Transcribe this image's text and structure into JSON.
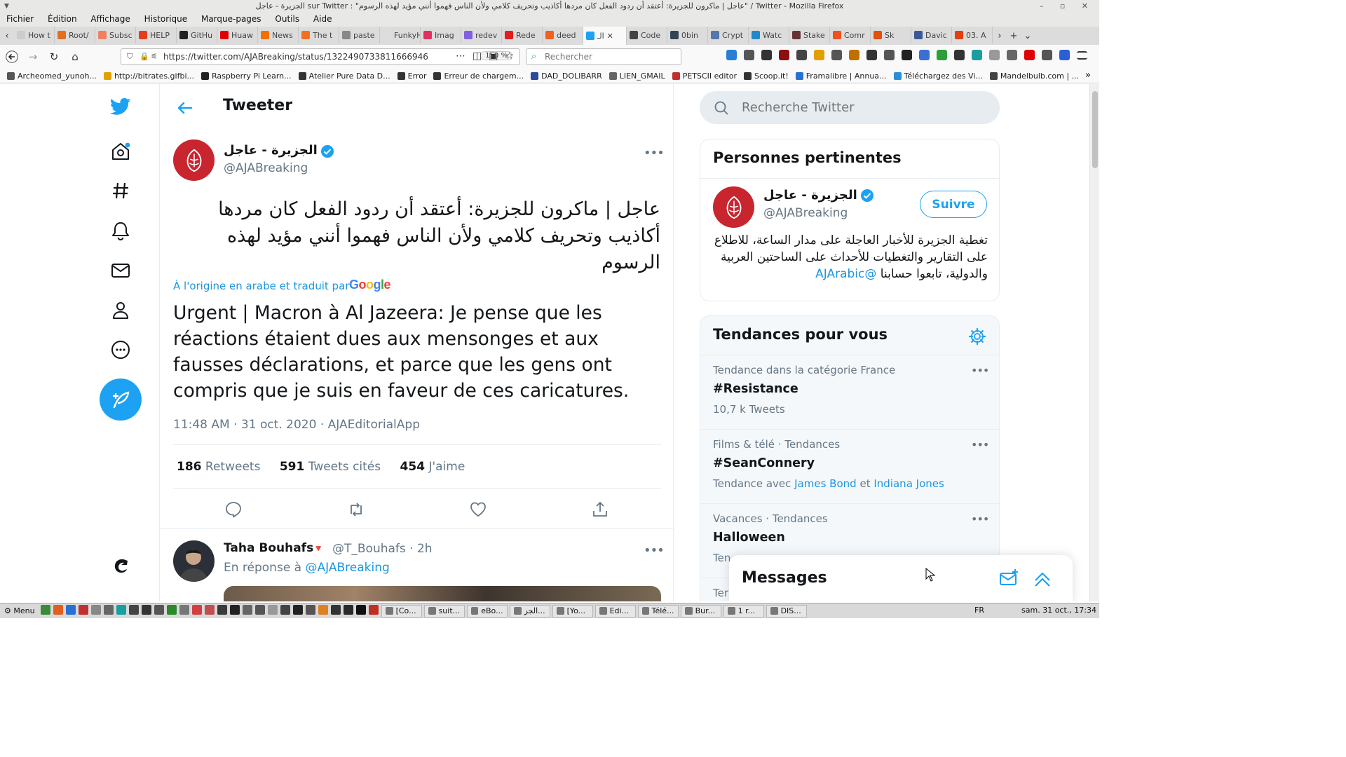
{
  "window": {
    "title": "الجزيرة - عاجل sur Twitter : \"عاجل | ماكرون للجزيرة: أعتقد أن ردود الفعل كان مردها أكاذيب وتحريف كلامي ولأن الناس فهموا أنني مؤيد لهذه الرسوم\" / Twitter - Mozilla Firefox",
    "controls": "–  ▫  ✕"
  },
  "menubar": [
    "Fichier",
    "Édition",
    "Affichage",
    "Historique",
    "Marque-pages",
    "Outils",
    "Aide"
  ],
  "tabs": [
    {
      "label": "How t",
      "color": "#cccccc"
    },
    {
      "label": "Root/",
      "color": "#e07020"
    },
    {
      "label": "Subsc",
      "color": "#f08060"
    },
    {
      "label": "HELP",
      "color": "#e04020"
    },
    {
      "label": "GitHu",
      "color": "#222222"
    },
    {
      "label": "Huaw",
      "color": "#e00000"
    },
    {
      "label": "News",
      "color": "#f07000"
    },
    {
      "label": "The t",
      "color": "#f07020"
    },
    {
      "label": "paste",
      "color": "#888888"
    },
    {
      "label": "FunkyHu",
      "color": "#dddddd"
    },
    {
      "label": "Imag",
      "color": "#e03060"
    },
    {
      "label": "redev",
      "color": "#8060e0"
    },
    {
      "label": "Rede",
      "color": "#e02020"
    },
    {
      "label": "deed",
      "color": "#f06020"
    },
    {
      "label": "الـ",
      "color": "#1da1f2",
      "active": true
    },
    {
      "label": "Code",
      "color": "#444444"
    },
    {
      "label": "0bin",
      "color": "#334455"
    },
    {
      "label": "Crypt",
      "color": "#5577aa"
    },
    {
      "label": "Watc",
      "color": "#2288cc"
    },
    {
      "label": "Stake",
      "color": "#663333"
    },
    {
      "label": "Comr",
      "color": "#f05020"
    },
    {
      "label": "Sk",
      "color": "#e05010"
    },
    {
      "label": "Davic",
      "color": "#3b5998"
    },
    {
      "label": "03. A",
      "color": "#e04010"
    }
  ],
  "nav": {
    "url": "https://twitter.com/AJABreaking/status/1322490733811666946",
    "zoom": "150 %",
    "search_placeholder": "Rechercher"
  },
  "bookmarks": [
    "Archeomed_yunoh...",
    "http://bitrates.gifbi...",
    "Raspberry Pi Learn...",
    "Atelier Pure Data D...",
    "Error",
    "Erreur de chargem...",
    "DAD_DOLIBARR",
    "LIEN_GMAIL",
    "PETSCII editor",
    "Scoop.it!",
    "Framalibre | Annua...",
    "Téléchargez des Vi...",
    "Mandelbulb.com | ..."
  ],
  "twitter": {
    "header_title": "Tweeter",
    "tweet": {
      "author_name": "الجزيرة - عاجل",
      "author_handle": "@AJABreaking",
      "text_ar": "عاجل | ماكرون للجزيرة: أعتقد أن ردود الفعل كان مردها أكاذيب وتحريف كلامي ولأن الناس فهموا أنني مؤيد لهذه الرسوم",
      "translation_note": "À l'origine en arabe et traduit par",
      "translation_provider": "Google",
      "text_fr": "Urgent | Macron à Al Jazeera: Je pense que les réactions étaient dues aux mensonges et aux fausses déclarations, et parce que les gens ont compris que je suis en faveur de ces caricatures.",
      "meta": "11:48 AM · 31 oct. 2020 · AJAEditorialApp",
      "retweets_count": "186",
      "retweets_label": "Retweets",
      "quotes_count": "591",
      "quotes_label": "Tweets cités",
      "likes_count": "454",
      "likes_label": "J'aime"
    },
    "reply": {
      "name": "Taha Bouhafs",
      "flag": "🔻",
      "handle": "@T_Bouhafs · 2h",
      "reply_to_prefix": "En réponse à",
      "reply_to_handle": "@AJABreaking"
    },
    "search_placeholder": "Recherche Twitter",
    "people": {
      "title": "Personnes pertinentes",
      "name": "الجزيرة - عاجل",
      "handle": "@AJABreaking",
      "follow_label": "Suivre",
      "bio": "تغطية الجزيرة للأخبار العاجلة على مدار الساعة، للاطلاع على التقارير والتغطيات للأحداث على الساحتين العربية والدولية، تابعوا حسابنا",
      "bio_mention": "@AJArabic"
    },
    "trends": {
      "title": "Tendances pour vous",
      "items": [
        {
          "context": "Tendance dans la catégorie France",
          "name": "#Resistance",
          "sub": "10,7 k Tweets"
        },
        {
          "context": "Films & télé · Tendances",
          "name": "#SeanConnery",
          "sub_prefix": "Tendance avec",
          "sub_link1": "James Bond",
          "sub_mid": "et",
          "sub_link2": "Indiana Jones"
        },
        {
          "context": "Vacances · Tendances",
          "name": "Halloween",
          "sub": "Ten"
        },
        {
          "context": "Ter"
        }
      ]
    },
    "messages_title": "Messages",
    "colors": {
      "accent": "#1da1f2",
      "aj_red": "#c8252e",
      "text": "#14171a",
      "muted": "#657786"
    }
  },
  "taskbar": {
    "menu_label": "Menu",
    "tasks": [
      "[Co...",
      "suit...",
      "eBo...",
      "الجز...",
      "[Yo...",
      "Edi...",
      "Télé...",
      "Bur...",
      "1 r...",
      "DIS..."
    ],
    "lang": "FR",
    "clock": "sam. 31 oct., 17:34"
  }
}
